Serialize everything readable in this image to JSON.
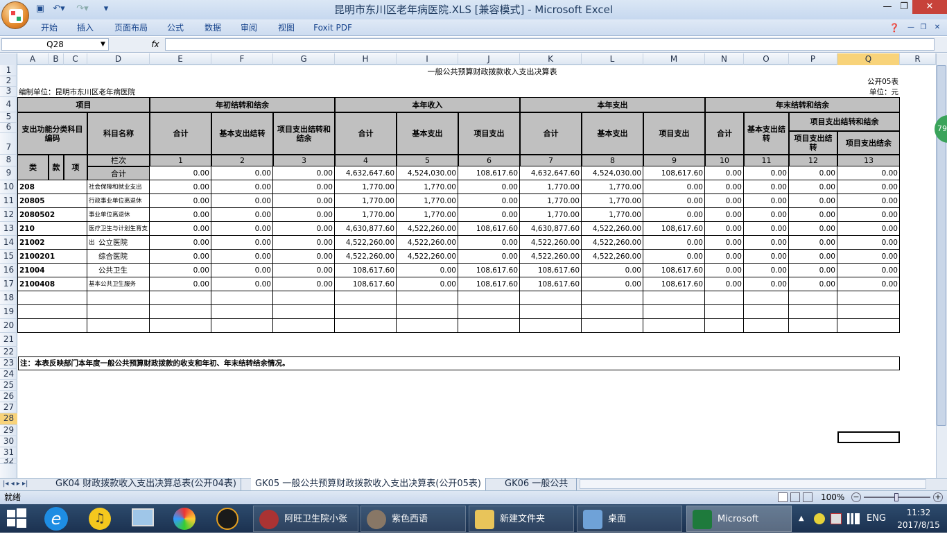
{
  "window": {
    "title": "昆明市东川区老年病医院.XLS  [兼容模式] - Microsoft Excel"
  },
  "ribbon_tabs": [
    "开始",
    "插入",
    "页面布局",
    "公式",
    "数据",
    "审阅",
    "视图",
    "Foxit PDF"
  ],
  "formula_bar": {
    "name_box": "Q28",
    "fx": "fx",
    "value": ""
  },
  "columns": [
    "A",
    "B",
    "C",
    "D",
    "E",
    "F",
    "G",
    "H",
    "I",
    "J",
    "K",
    "L",
    "M",
    "N",
    "O",
    "P",
    "Q",
    "R"
  ],
  "rows": [
    "1",
    "2",
    "3",
    "4",
    "5",
    "6",
    "7",
    "8",
    "9",
    "10",
    "11",
    "12",
    "13",
    "14",
    "15",
    "16",
    "17",
    "18",
    "19",
    "20",
    "21",
    "22",
    "23",
    "24",
    "25",
    "26",
    "27",
    "28",
    "29",
    "30",
    "31",
    "32"
  ],
  "sheet": {
    "title": "一般公共预算财政拨款收入支出决算表",
    "form_code": "公开05表",
    "unit_label": "编制单位：昆明市东川区老年病医院",
    "unit": "单位：元",
    "headers": {
      "item": "项目",
      "begin": "年初结转和结余",
      "income": "本年收入",
      "expense": "本年支出",
      "end": "年末结转和结余",
      "func_code": "支出功能分类科目编码",
      "subject_name": "科目名称",
      "total": "合计",
      "basic_carry": "基本支出结转",
      "project_carry": "项目支出结转和结余",
      "basic_exp": "基本支出",
      "project_exp": "项目支出",
      "end_project": "项目支出结转和结余",
      "end_project_carry": "项目支出结转",
      "end_project_balance": "项目支出结余",
      "lei": "类",
      "kuan": "款",
      "xiang": "项",
      "lanci": "栏次",
      "col_nums": [
        "1",
        "2",
        "3",
        "4",
        "5",
        "6",
        "7",
        "8",
        "9",
        "10",
        "11",
        "12",
        "13"
      ]
    },
    "total_label": "合计",
    "total_row": [
      "0.00",
      "0.00",
      "0.00",
      "4,632,647.60",
      "4,524,030.00",
      "108,617.60",
      "4,632,647.60",
      "4,524,030.00",
      "108,617.60",
      "0.00",
      "0.00",
      "0.00",
      "0.00"
    ],
    "data_rows": [
      {
        "code": "208",
        "name": "社会保障和就业支出",
        "values": [
          "0.00",
          "0.00",
          "0.00",
          "1,770.00",
          "1,770.00",
          "0.00",
          "1,770.00",
          "1,770.00",
          "0.00",
          "0.00",
          "0.00",
          "0.00",
          "0.00"
        ]
      },
      {
        "code": "20805",
        "name": "行政事业单位离退休",
        "values": [
          "0.00",
          "0.00",
          "0.00",
          "1,770.00",
          "1,770.00",
          "0.00",
          "1,770.00",
          "1,770.00",
          "0.00",
          "0.00",
          "0.00",
          "0.00",
          "0.00"
        ]
      },
      {
        "code": "2080502",
        "name": "事业单位离退休",
        "values": [
          "0.00",
          "0.00",
          "0.00",
          "1,770.00",
          "1,770.00",
          "0.00",
          "1,770.00",
          "1,770.00",
          "0.00",
          "0.00",
          "0.00",
          "0.00",
          "0.00"
        ]
      },
      {
        "code": "210",
        "name": "医疗卫生与计划生育支出",
        "values": [
          "0.00",
          "0.00",
          "0.00",
          "4,630,877.60",
          "4,522,260.00",
          "108,617.60",
          "4,630,877.60",
          "4,522,260.00",
          "108,617.60",
          "0.00",
          "0.00",
          "0.00",
          "0.00"
        ]
      },
      {
        "code": "21002",
        "name": "公立医院",
        "values": [
          "0.00",
          "0.00",
          "0.00",
          "4,522,260.00",
          "4,522,260.00",
          "0.00",
          "4,522,260.00",
          "4,522,260.00",
          "0.00",
          "0.00",
          "0.00",
          "0.00",
          "0.00"
        ]
      },
      {
        "code": "2100201",
        "name": "综合医院",
        "values": [
          "0.00",
          "0.00",
          "0.00",
          "4,522,260.00",
          "4,522,260.00",
          "0.00",
          "4,522,260.00",
          "4,522,260.00",
          "0.00",
          "0.00",
          "0.00",
          "0.00",
          "0.00"
        ]
      },
      {
        "code": "21004",
        "name": "公共卫生",
        "values": [
          "0.00",
          "0.00",
          "0.00",
          "108,617.60",
          "0.00",
          "108,617.60",
          "108,617.60",
          "0.00",
          "108,617.60",
          "0.00",
          "0.00",
          "0.00",
          "0.00"
        ]
      },
      {
        "code": "2100408",
        "name": "基本公共卫生服务",
        "values": [
          "0.00",
          "0.00",
          "0.00",
          "108,617.60",
          "0.00",
          "108,617.60",
          "108,617.60",
          "0.00",
          "108,617.60",
          "0.00",
          "0.00",
          "0.00",
          "0.00"
        ]
      }
    ],
    "note": "注：本表反映部门本年度一般公共预算财政拨款的收支和年初、年末结转结余情况。"
  },
  "sheet_tabs": [
    "GK04 财政拨款收入支出决算总表(公开04表)",
    "GK05 一般公共预算财政拨款收入支出决算表(公开05表)",
    "GK06 一般公共"
  ],
  "status": {
    "ready": "就绪",
    "zoom": "100%"
  },
  "taskbar": {
    "items": [
      "阿旺卫生院小张",
      "紫色西语",
      "新建文件夹",
      "桌面",
      "Microsoft Excel..."
    ],
    "lang": "ENG",
    "time": "11:32",
    "date": "2017/8/15"
  },
  "badge": "79"
}
